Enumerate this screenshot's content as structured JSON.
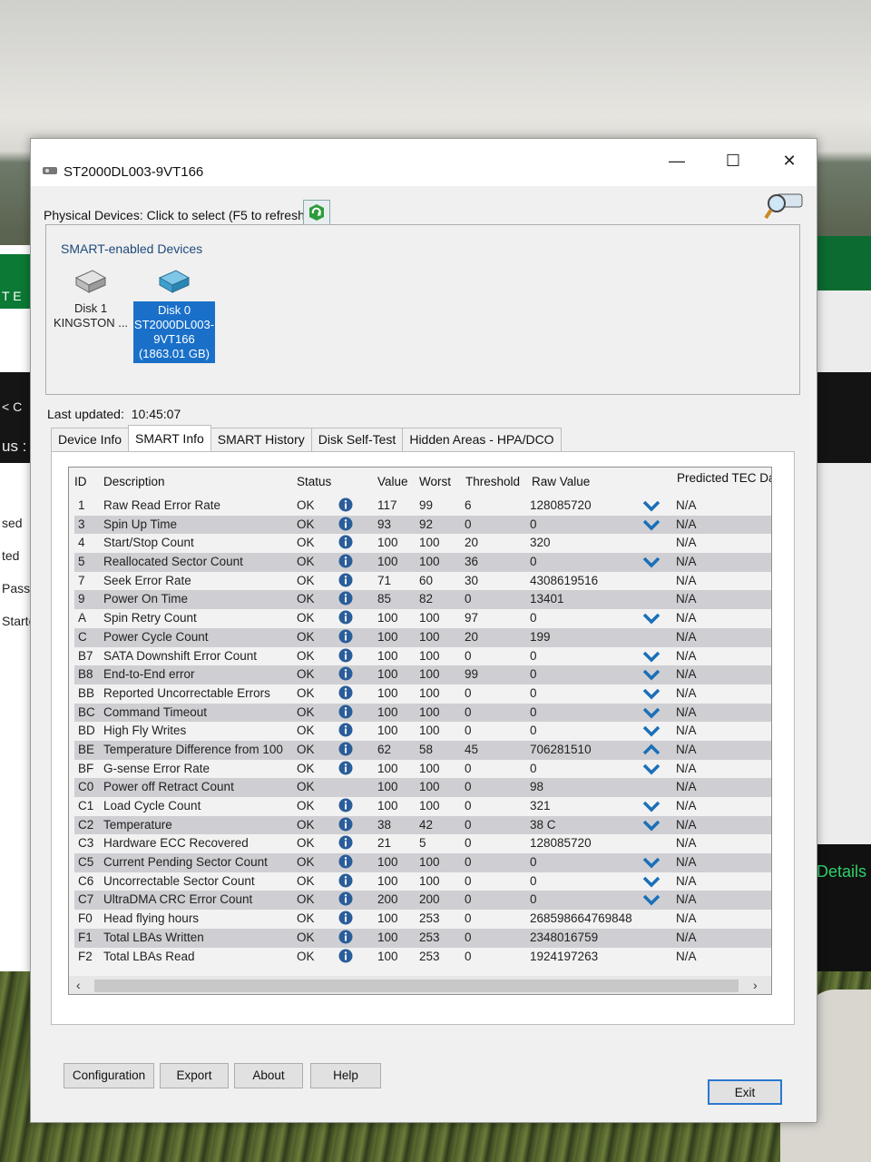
{
  "window": {
    "title": "ST2000DL003-9VT166",
    "controls": {
      "minimize": "—",
      "maximize": "☐",
      "close": "✕"
    }
  },
  "physical_devices_label": "Physical Devices: Click to select (F5 to refresh)",
  "devices": {
    "legend": "SMART-enabled Devices",
    "items": [
      {
        "line1": "Disk 1",
        "line2": "KINGSTON ...",
        "line3": "",
        "line4": "",
        "selected": false
      },
      {
        "line1": "Disk 0",
        "line2": "ST2000DL003-",
        "line3": "9VT166",
        "line4": "(1863.01 GB)",
        "selected": true
      }
    ]
  },
  "last_updated": {
    "label": "Last updated:",
    "value": "10:45:07"
  },
  "tabs": [
    {
      "label": "Device Info",
      "active": false
    },
    {
      "label": "SMART Info",
      "active": true
    },
    {
      "label": "SMART History",
      "active": false
    },
    {
      "label": "Disk Self-Test",
      "active": false
    },
    {
      "label": "Hidden Areas - HPA/DCO",
      "active": false
    }
  ],
  "table": {
    "headers": {
      "id": "ID",
      "desc": "Description",
      "status": "Status",
      "value": "Value",
      "worst": "Worst",
      "threshold": "Threshold",
      "raw": "Raw Value",
      "pred": "Predicted TEC Dat"
    },
    "rows": [
      {
        "id": "1",
        "desc": "Raw Read Error Rate",
        "status": "OK",
        "info": true,
        "value": "117",
        "worst": "99",
        "thr": "6",
        "raw": "128085720",
        "arrow": "down",
        "pred": "N/A"
      },
      {
        "id": "3",
        "desc": "Spin Up Time",
        "status": "OK",
        "info": true,
        "value": "93",
        "worst": "92",
        "thr": "0",
        "raw": "0",
        "arrow": "down",
        "pred": "N/A"
      },
      {
        "id": "4",
        "desc": "Start/Stop Count",
        "status": "OK",
        "info": true,
        "value": "100",
        "worst": "100",
        "thr": "20",
        "raw": "320",
        "arrow": "",
        "pred": "N/A"
      },
      {
        "id": "5",
        "desc": "Reallocated Sector Count",
        "status": "OK",
        "info": true,
        "value": "100",
        "worst": "100",
        "thr": "36",
        "raw": "0",
        "arrow": "down",
        "pred": "N/A"
      },
      {
        "id": "7",
        "desc": "Seek Error Rate",
        "status": "OK",
        "info": true,
        "value": "71",
        "worst": "60",
        "thr": "30",
        "raw": "4308619516",
        "arrow": "",
        "pred": "N/A"
      },
      {
        "id": "9",
        "desc": "Power On Time",
        "status": "OK",
        "info": true,
        "value": "85",
        "worst": "82",
        "thr": "0",
        "raw": "13401",
        "arrow": "",
        "pred": "N/A"
      },
      {
        "id": "A",
        "desc": "Spin Retry Count",
        "status": "OK",
        "info": true,
        "value": "100",
        "worst": "100",
        "thr": "97",
        "raw": "0",
        "arrow": "down",
        "pred": "N/A"
      },
      {
        "id": "C",
        "desc": "Power Cycle Count",
        "status": "OK",
        "info": true,
        "value": "100",
        "worst": "100",
        "thr": "20",
        "raw": "199",
        "arrow": "",
        "pred": "N/A"
      },
      {
        "id": "B7",
        "desc": "SATA Downshift Error Count",
        "status": "OK",
        "info": true,
        "value": "100",
        "worst": "100",
        "thr": "0",
        "raw": "0",
        "arrow": "down",
        "pred": "N/A"
      },
      {
        "id": "B8",
        "desc": "End-to-End error",
        "status": "OK",
        "info": true,
        "value": "100",
        "worst": "100",
        "thr": "99",
        "raw": "0",
        "arrow": "down",
        "pred": "N/A"
      },
      {
        "id": "BB",
        "desc": "Reported Uncorrectable Errors",
        "status": "OK",
        "info": true,
        "value": "100",
        "worst": "100",
        "thr": "0",
        "raw": "0",
        "arrow": "down",
        "pred": "N/A"
      },
      {
        "id": "BC",
        "desc": "Command Timeout",
        "status": "OK",
        "info": true,
        "value": "100",
        "worst": "100",
        "thr": "0",
        "raw": "0",
        "arrow": "down",
        "pred": "N/A"
      },
      {
        "id": "BD",
        "desc": "High Fly Writes",
        "status": "OK",
        "info": true,
        "value": "100",
        "worst": "100",
        "thr": "0",
        "raw": "0",
        "arrow": "down",
        "pred": "N/A"
      },
      {
        "id": "BE",
        "desc": "Temperature Difference from 100",
        "status": "OK",
        "info": true,
        "value": "62",
        "worst": "58",
        "thr": "45",
        "raw": "706281510",
        "arrow": "up",
        "pred": "N/A"
      },
      {
        "id": "BF",
        "desc": "G-sense Error Rate",
        "status": "OK",
        "info": true,
        "value": "100",
        "worst": "100",
        "thr": "0",
        "raw": "0",
        "arrow": "down",
        "pred": "N/A"
      },
      {
        "id": "C0",
        "desc": "Power off Retract Count",
        "status": "OK",
        "info": false,
        "value": "100",
        "worst": "100",
        "thr": "0",
        "raw": "98",
        "arrow": "",
        "pred": "N/A"
      },
      {
        "id": "C1",
        "desc": "Load Cycle Count",
        "status": "OK",
        "info": true,
        "value": "100",
        "worst": "100",
        "thr": "0",
        "raw": "321",
        "arrow": "down",
        "pred": "N/A"
      },
      {
        "id": "C2",
        "desc": "Temperature",
        "status": "OK",
        "info": true,
        "value": "38",
        "worst": "42",
        "thr": "0",
        "raw": "38 C",
        "arrow": "down",
        "pred": "N/A"
      },
      {
        "id": "C3",
        "desc": "Hardware ECC Recovered",
        "status": "OK",
        "info": true,
        "value": "21",
        "worst": "5",
        "thr": "0",
        "raw": "128085720",
        "arrow": "",
        "pred": "N/A"
      },
      {
        "id": "C5",
        "desc": "Current Pending Sector Count",
        "status": "OK",
        "info": true,
        "value": "100",
        "worst": "100",
        "thr": "0",
        "raw": "0",
        "arrow": "down",
        "pred": "N/A"
      },
      {
        "id": "C6",
        "desc": "Uncorrectable Sector Count",
        "status": "OK",
        "info": true,
        "value": "100",
        "worst": "100",
        "thr": "0",
        "raw": "0",
        "arrow": "down",
        "pred": "N/A"
      },
      {
        "id": "C7",
        "desc": "UltraDMA CRC Error Count",
        "status": "OK",
        "info": true,
        "value": "200",
        "worst": "200",
        "thr": "0",
        "raw": "0",
        "arrow": "down",
        "pred": "N/A"
      },
      {
        "id": "F0",
        "desc": "Head flying hours",
        "status": "OK",
        "info": true,
        "value": "100",
        "worst": "253",
        "thr": "0",
        "raw": "268598664769848",
        "arrow": "",
        "pred": "N/A"
      },
      {
        "id": "F1",
        "desc": "Total LBAs Written",
        "status": "OK",
        "info": true,
        "value": "100",
        "worst": "253",
        "thr": "0",
        "raw": "2348016759",
        "arrow": "",
        "pred": "N/A"
      },
      {
        "id": "F2",
        "desc": "Total LBAs Read",
        "status": "OK",
        "info": true,
        "value": "100",
        "worst": "253",
        "thr": "0",
        "raw": "1924197263",
        "arrow": "",
        "pred": "N/A"
      }
    ]
  },
  "buttons": {
    "configuration": "Configuration",
    "export": "Export",
    "about": "About",
    "help": "Help",
    "exit": "Exit"
  },
  "background": {
    "left_labels": [
      "T E",
      "< C",
      "us :",
      "sed",
      "ted",
      "Passec",
      "Starte"
    ],
    "right_label": "e Details"
  },
  "colors": {
    "selection": "#1a70c9",
    "arrow": "#1a6fb8",
    "info_icon": "#2a5d9a",
    "alt_row": "#cfcfd3",
    "refresh_icon": "#2e9b3b"
  }
}
